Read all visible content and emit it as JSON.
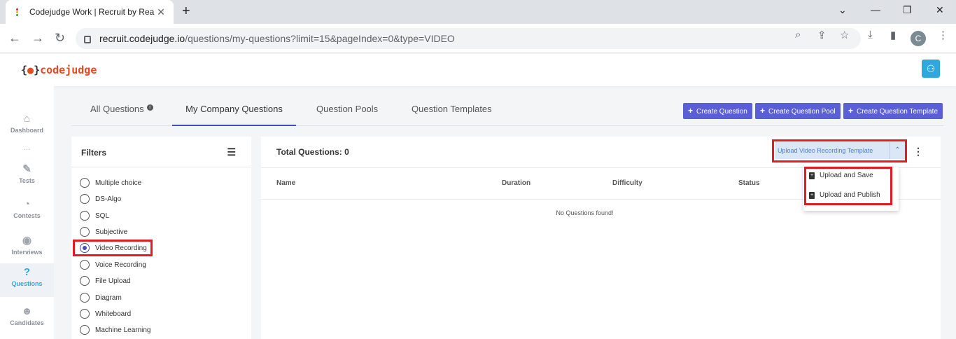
{
  "browser": {
    "tab_title": "Codejudge Work | Recruit by Rea",
    "url_host": "recruit.codejudge.io",
    "url_path": "/questions/my-questions?limit=15&pageIndex=0&type=VIDEO",
    "profile_initial": "C"
  },
  "app": {
    "logo_left": "{",
    "logo_text": "codejudge",
    "logo_right": "}"
  },
  "sidebar": {
    "items": [
      {
        "label": "Dashboard",
        "icon": "home-icon"
      },
      {
        "label": "Tests",
        "icon": "pencil-icon"
      },
      {
        "label": "Contests",
        "icon": "pie-chart-icon"
      },
      {
        "label": "Interviews",
        "icon": "podcast-icon"
      },
      {
        "label": "Questions",
        "icon": "question-icon"
      },
      {
        "label": "Candidates",
        "icon": "users-icon"
      }
    ],
    "dots": "..."
  },
  "tabs": {
    "all": "All Questions",
    "mine": "My Company Questions",
    "pools": "Question Pools",
    "templates": "Question Templates"
  },
  "actions": {
    "create_question": "Create Question",
    "create_pool": "Create Question Pool",
    "create_template": "Create Question Template"
  },
  "filters": {
    "title": "Filters",
    "options": [
      "Multiple choice",
      "DS-Algo",
      "SQL",
      "Subjective",
      "Video Recording",
      "Voice Recording",
      "File Upload",
      "Diagram",
      "Whiteboard",
      "Machine Learning"
    ],
    "selected": "Video Recording"
  },
  "main": {
    "total": "Total Questions: 0",
    "upload_button": "Upload Video Recording Template",
    "columns": [
      "Name",
      "Duration",
      "Difficulty",
      "Status"
    ],
    "empty": "No Questions found!"
  },
  "dropdown": {
    "upload_save": "Upload and Save",
    "upload_publish": "Upload and Publish"
  },
  "colors": {
    "accent": "#5b5fd6",
    "highlight": "#e31b23",
    "brand": "#e8491d"
  }
}
